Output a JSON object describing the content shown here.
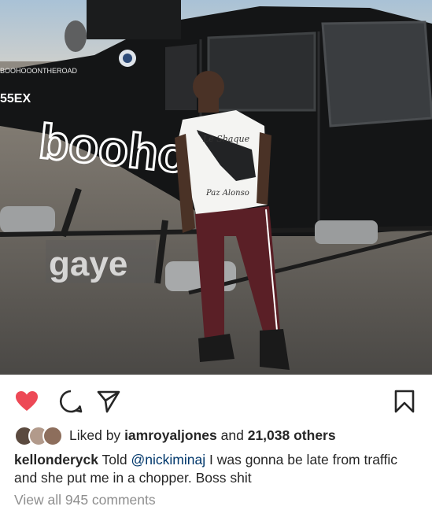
{
  "photo": {
    "helicopter_tail_text": "BOOHOOONTHEROAD",
    "helicopter_reg_text": "55EX",
    "helicopter_brand_text": "boohoo.c",
    "shirt_text_top": "Le Shaque",
    "shirt_text_bottom": "Paz Alonso",
    "watermark": "gaye"
  },
  "actions": {
    "like_icon": "heart-filled-icon",
    "comment_icon": "comment-icon",
    "share_icon": "paper-plane-icon",
    "save_icon": "bookmark-icon",
    "like_color": "#ed4956"
  },
  "likes": {
    "prefix": "Liked by",
    "first_user": "iamroyaljones",
    "middle": "and",
    "others": "21,038 others"
  },
  "caption": {
    "username": "kellonderyck",
    "text_before": "Told",
    "mention": "@nickiminaj",
    "text_after": "I was gonna be late from traffic and she put me in a chopper. Boss shit"
  },
  "comments": {
    "view_all": "View all 945 comments"
  }
}
